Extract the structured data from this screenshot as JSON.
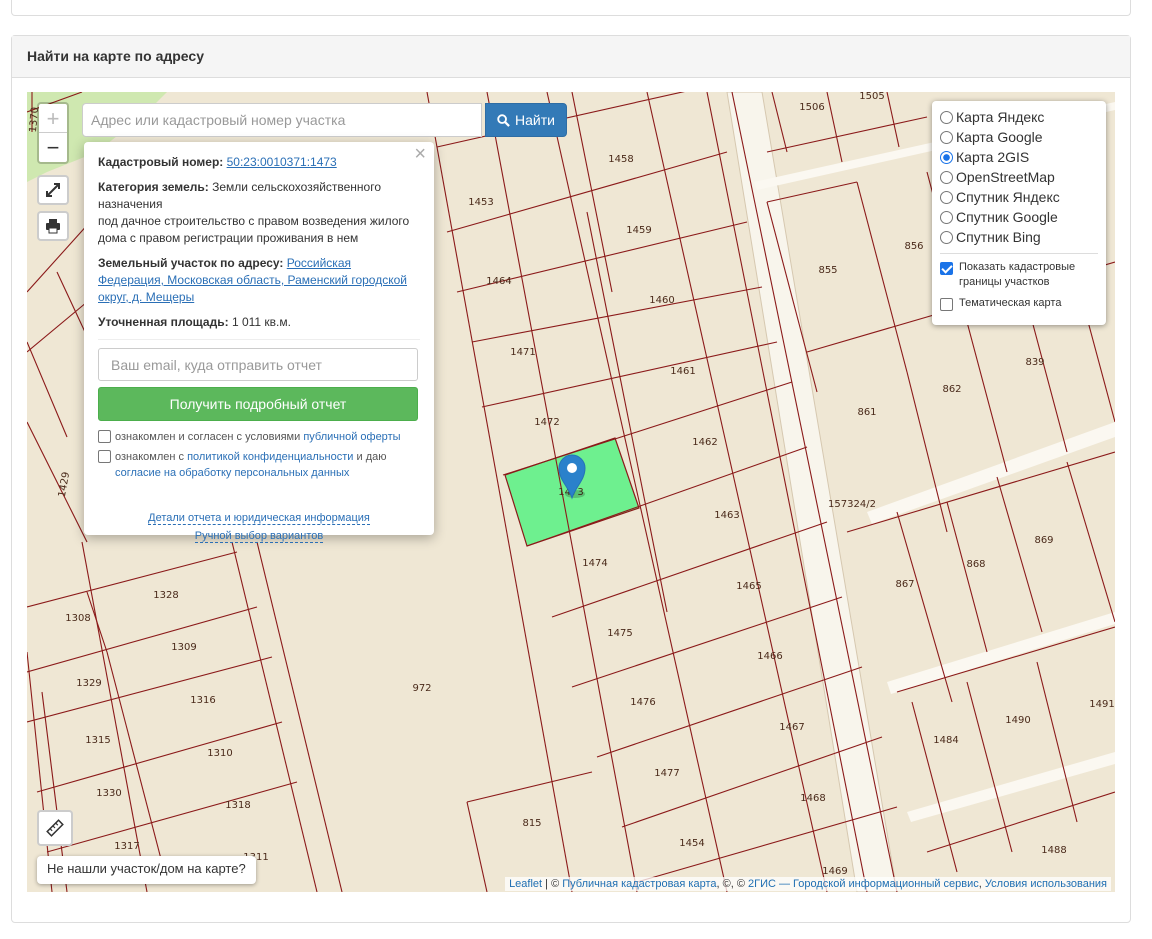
{
  "panel": {
    "title": "Найти на карте по адресу"
  },
  "search": {
    "placeholder": "Адрес или кадастровый номер участка",
    "button_label": "Найти"
  },
  "zoom": {
    "in": "+",
    "out": "−"
  },
  "popup": {
    "cad_label": "Кадастровый номер:",
    "cad_value": "50:23:0010371:1473",
    "cat_label": "Категория земель:",
    "cat_value": "Земли сельскохозяйственного назначения",
    "cat_use": "под дачное строительство с правом возведения жилого дома с правом регистрации проживания в нем",
    "addr_label": "Земельный участок по адресу:",
    "addr_value": "Российская Федерация, Московская область, Раменский городской округ, д. Мещеры",
    "area_label": "Уточненная площадь:",
    "area_value": "1 011 кв.м.",
    "email_placeholder": "Ваш email, куда отправить отчет",
    "report_button": "Получить подробный отчет",
    "agree1_text": "ознакомлен и согласен с условиями",
    "agree1_link": "публичной оферты",
    "agree2_text": "ознакомлен с",
    "agree2_link": "политикой конфиденциальности",
    "agree2_mid": "и даю",
    "agree2_link2": "согласие на обработку персональных данных",
    "link_details": "Детали отчета и юридическая информация",
    "link_manual": "Ручной выбор вариантов"
  },
  "layers": {
    "options": [
      {
        "label": "Карта Яндекс",
        "checked": false
      },
      {
        "label": "Карта Google",
        "checked": false
      },
      {
        "label": "Карта 2GIS",
        "checked": true
      },
      {
        "label": "OpenStreetMap",
        "checked": false
      },
      {
        "label": "Спутник Яндекс",
        "checked": false
      },
      {
        "label": "Спутник Google",
        "checked": false
      },
      {
        "label": "Спутник Bing",
        "checked": false
      }
    ],
    "show_borders": "Показать кадастровые границы участков",
    "thematic": "Тематическая карта"
  },
  "map": {
    "parcel_labels": [
      "1506",
      "1505",
      "1458",
      "1453",
      "1459",
      "1464",
      "1460",
      "1471",
      "1461",
      "1472",
      "1462",
      "1473",
      "1463",
      "1474",
      "1465",
      "1475",
      "1466",
      "1476",
      "1467",
      "1477",
      "1468",
      "1454",
      "1469",
      "815",
      "972",
      "855",
      "856",
      "861",
      "862",
      "839",
      "157324/2",
      "867",
      "868",
      "869",
      "1484",
      "1490",
      "1491",
      "1488",
      "1328",
      "1308",
      "1309",
      "1329",
      "1316",
      "1315",
      "1310",
      "1330",
      "1318",
      "1317",
      "1311",
      "1429",
      "1370"
    ],
    "selected_parcel": "1473",
    "highlight_color": "#6ef08f",
    "boundary_color": "#8b1a1a"
  },
  "notfound": "Не нашли участок/дом на карте?",
  "attribution": {
    "leaflet": "Leaflet",
    "sep": "| ©",
    "pkk": "Публичная кадастровая карта",
    "mid": ", ©, ©",
    "gis": "2ГИС — Городской информационный сервис",
    "comma": ",",
    "terms": "Условия использования"
  }
}
